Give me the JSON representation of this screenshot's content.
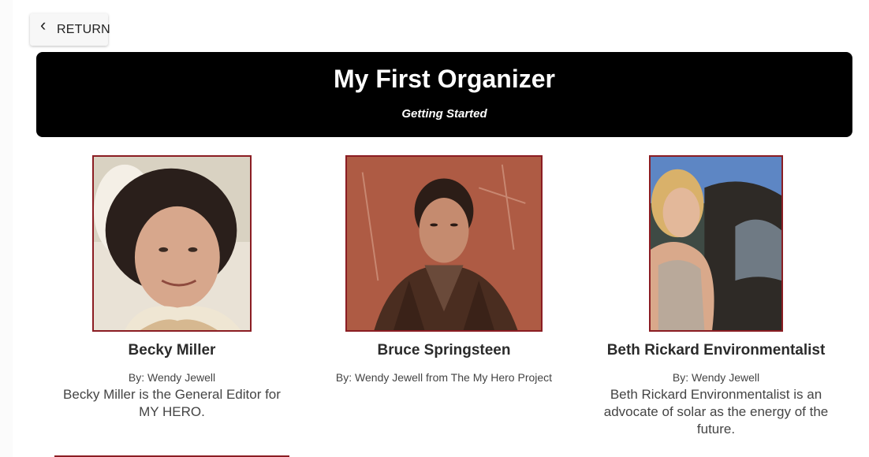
{
  "nav": {
    "return_label": "RETURN"
  },
  "banner": {
    "title": "My First Organizer",
    "subtitle": "Getting Started"
  },
  "cards": [
    {
      "name": "Becky Miller",
      "byline": "By: Wendy Jewell",
      "description": "Becky Miller is the General Editor for MY HERO."
    },
    {
      "name": "Bruce Springsteen",
      "byline": "By: Wendy Jewell from The My Hero Project",
      "description": ""
    },
    {
      "name": "Beth Rickard Environmentalist",
      "byline": "By: Wendy Jewell",
      "description": "Beth Rickard Environmentalist is an advocate of solar as the energy of the future."
    }
  ],
  "colors": {
    "banner_bg": "#000000",
    "photo_border": "#8b1d23",
    "text": "#333333"
  }
}
